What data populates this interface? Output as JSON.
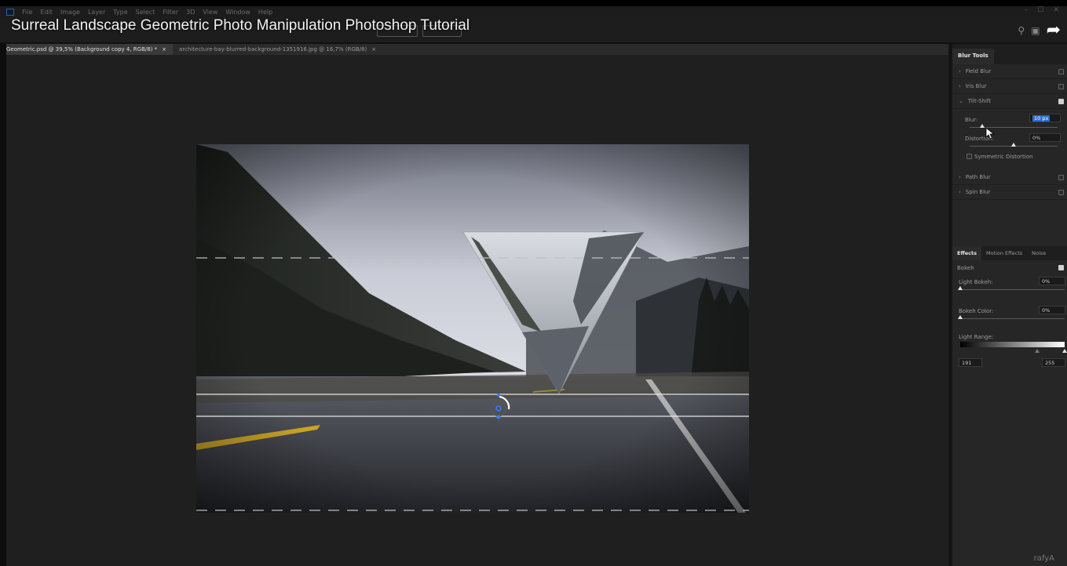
{
  "video": {
    "title": "Surreal Landscape Geometric Photo Manipulation Photoshop Tutorial"
  },
  "menu": {
    "items": [
      "File",
      "Edit",
      "Image",
      "Layer",
      "Type",
      "Select",
      "Filter",
      "3D",
      "View",
      "Window",
      "Help"
    ],
    "window_controls": [
      "–",
      "☐",
      "✕"
    ]
  },
  "tabs": [
    {
      "label": "Geometric.psd @ 39,5% (Background copy 4, RGB/8) *",
      "close": "×"
    },
    {
      "label": "architecture-bay-blurred-background-1351916.jpg @ 16,7% (RGB/8)",
      "close": "×"
    }
  ],
  "panel": {
    "title": "Blur Tools",
    "blur_tools": [
      {
        "label": "Field Blur",
        "checked": false,
        "expanded": false
      },
      {
        "label": "Iris Blur",
        "checked": false,
        "expanded": false
      },
      {
        "label": "Tilt-Shift",
        "checked": true,
        "expanded": true
      },
      {
        "label": "Path Blur",
        "checked": false,
        "expanded": false
      },
      {
        "label": "Spin Blur",
        "checked": false,
        "expanded": false
      }
    ],
    "tilt_shift": {
      "blur_label": "Blur:",
      "blur_value": "10 px",
      "blur_level": 0.14,
      "distortion_label": "Distortion:",
      "distortion_value": "0%",
      "distortion_level": 0.5,
      "symmetric_label": "Symmetric Distortion"
    },
    "effects_tabs": [
      "Effects",
      "Motion Effects",
      "Noise"
    ],
    "effects": {
      "bokeh_label": "Bokeh",
      "light_bokeh_label": "Light Bokeh:",
      "light_bokeh_value": "0%",
      "bokeh_color_label": "Bokeh Color:",
      "bokeh_color_value": "0%",
      "light_range_label": "Light Range:",
      "light_range_low": "191",
      "light_range_high": "255"
    },
    "logo": "rafyA"
  },
  "colors": {
    "accent": "#2f6bd1",
    "pin": "#3d7bff",
    "road_line_yellow": "#c9a227"
  }
}
